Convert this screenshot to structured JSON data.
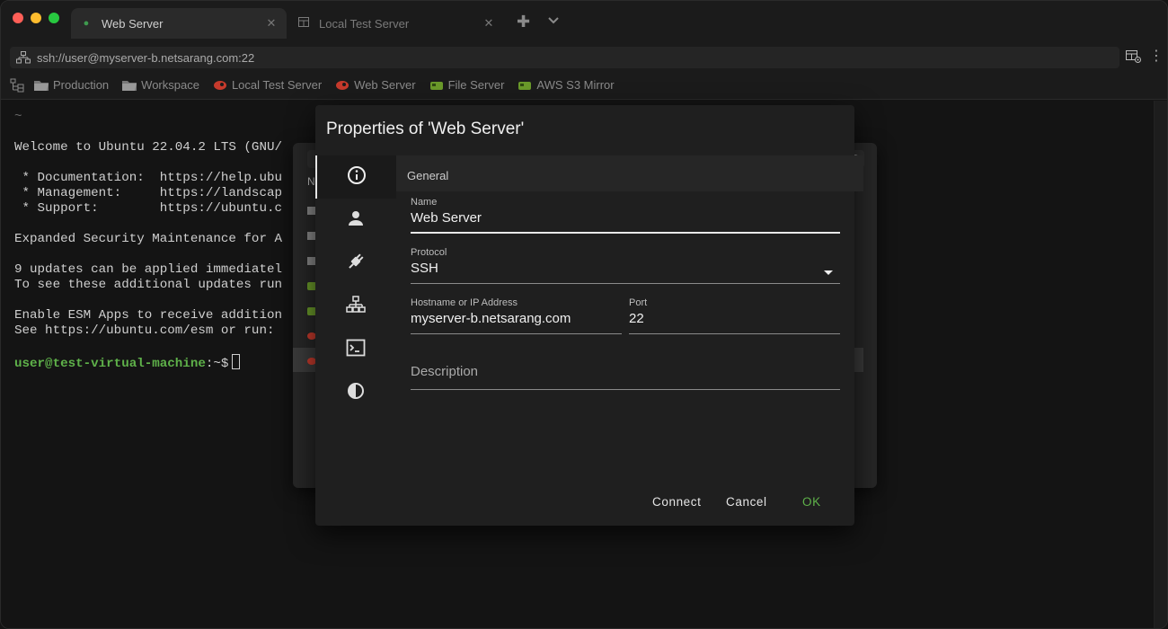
{
  "tabs": [
    {
      "label": "Web Server",
      "icon": "session-dot-icon",
      "active": true
    },
    {
      "label": "Local Test Server",
      "icon": "grid-tab-icon",
      "active": false
    }
  ],
  "tab_close_glyph": "✕",
  "tab_add_glyph": "✚",
  "more_glyph": "⋮",
  "address": {
    "value": "ssh://user@myserver-b.netsarang.com:22"
  },
  "bookmarks": [
    {
      "label": "Production",
      "icon": "folder-icon"
    },
    {
      "label": "Workspace",
      "icon": "folder-icon"
    },
    {
      "label": "Local Test Server",
      "icon": "ubuntu-icon"
    },
    {
      "label": "Web Server",
      "icon": "ubuntu-icon"
    },
    {
      "label": "File Server",
      "icon": "linux-icon"
    },
    {
      "label": "AWS S3 Mirror",
      "icon": "linux-icon"
    }
  ],
  "terminal": {
    "tilde": "~",
    "welcome": "Welcome to Ubuntu 22.04.2 LTS (GNU/",
    "doc": " * Documentation:  https://help.ubu",
    "mgmt": " * Management:     https://landscap",
    "support": " * Support:        https://ubuntu.c",
    "esm": "Expanded Security Maintenance for A",
    "updates1": "9 updates can be applied immediatel",
    "updates2": "To see these additional updates run",
    "enable": "Enable ESM Apps to receive addition",
    "see": "See https://ubuntu.com/esm or run: ",
    "prompt_user": "user@test-virtual-machine",
    "prompt_rest": ":~$"
  },
  "session_manager": {
    "header": "N"
  },
  "dialog": {
    "title": "Properties of 'Web Server'",
    "section": "General",
    "name_label": "Name",
    "name_value": "Web Server",
    "protocol_label": "Protocol",
    "protocol_value": "SSH",
    "host_label": "Hostname or IP Address",
    "host_value": "myserver-b.netsarang.com",
    "port_label": "Port",
    "port_value": "22",
    "description_placeholder": "Description",
    "connect": "Connect",
    "cancel": "Cancel",
    "ok": "OK"
  },
  "colors": {
    "accent_green": "#5fb24a",
    "ubuntu_red": "#c63a2c",
    "linux_green": "#6a9a2a"
  }
}
